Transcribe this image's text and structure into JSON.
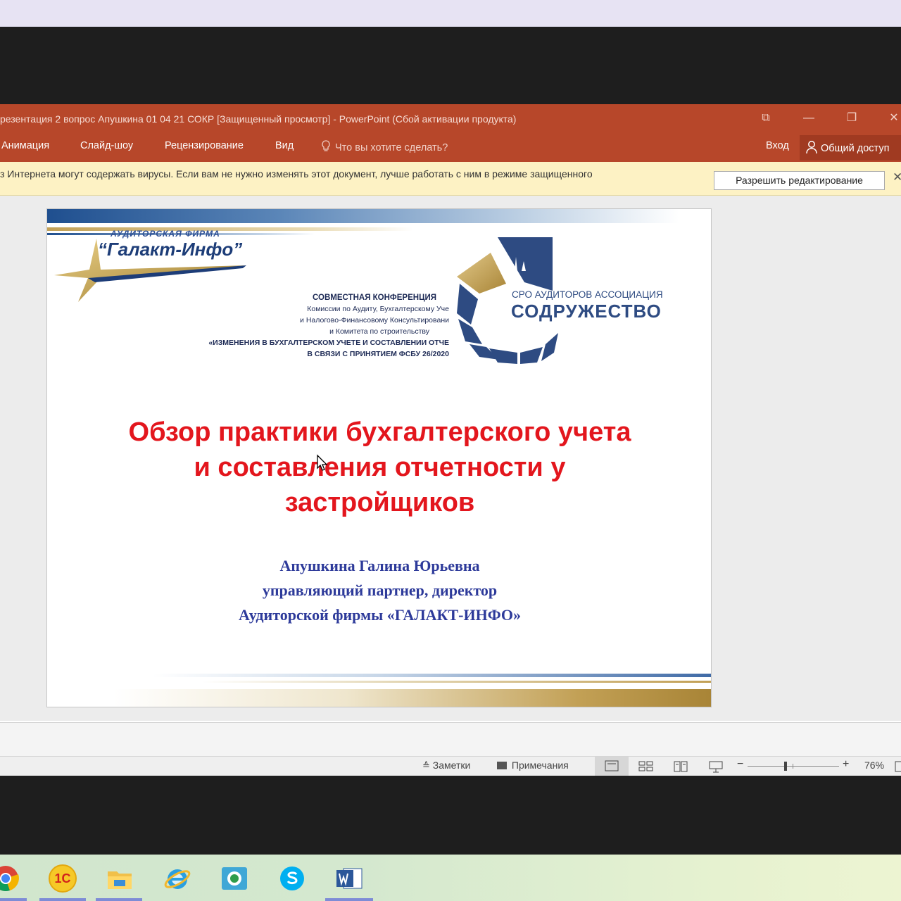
{
  "window": {
    "title": "резентация 2 вопрос Апушкина  01 04 21 СОКР [Защищенный просмотр] - PowerPoint (Сбой активации продукта)",
    "controls": {
      "ribbon_display": "⧉",
      "minimize": "—",
      "restore": "❐",
      "close": "✕"
    }
  },
  "ribbon": {
    "tabs": [
      "Анимация",
      "Слайд-шоу",
      "Рецензирование",
      "Вид"
    ],
    "tell_me": "Что вы хотите сделать?",
    "sign_in": "Вход",
    "share": "Общий доступ"
  },
  "message_bar": {
    "text": "з Интернета могут содержать вирусы. Если вам не нужно изменять этот документ, лучше работать с ним в режиме защищенного",
    "enable_button": "Разрешить редактирование",
    "close": "✕"
  },
  "slide": {
    "logo_left": {
      "caption": "АУДИТОРСКАЯ  ФИРМА",
      "name": "“Галакт-Инфо”"
    },
    "logo_right": {
      "line1": "СРО АУДИТОРОВ АССОЦИАЦИЯ",
      "line2": "СОДРУЖЕСТВО"
    },
    "conference": [
      "СОВМЕСТНАЯ КОНФЕРЕНЦИЯ",
      "Комиссии по Аудиту, Бухгалтерскому Уче",
      "и Налогово-Финансовому Консультировани",
      "и Комитета по строительству",
      "«ИЗМЕНЕНИЯ В БУХГАЛТЕРСКОМ УЧЕТЕ И СОСТАВЛЕНИИ ОТЧЕ",
      "В СВЯЗИ С ПРИНЯТИЕМ ФСБУ 26/2020"
    ],
    "title_lines": [
      "Обзор практики бухгалтерского учета",
      "и составления отчетности у",
      "застройщиков"
    ],
    "author_lines": [
      "Апушкина Галина Юрьевна",
      "управляющий партнер, директор",
      "Аудиторской фирмы «ГАЛАКТ-ИНФО»"
    ]
  },
  "statusbar": {
    "notes": "Заметки",
    "comments": "Примечания",
    "zoom_minus": "−",
    "zoom_plus": "+",
    "zoom": "76%",
    "zoom_level": 0.4
  },
  "taskbar": {
    "apps": [
      "chrome-icon",
      "1c-icon",
      "file-explorer-icon",
      "internet-explorer-icon",
      "remote-app-icon",
      "skype-icon",
      "word-icon"
    ],
    "onec_text": "1С"
  },
  "colors": {
    "ppt_accent": "#b7472a",
    "title_red": "#e3161d",
    "author_blue": "#2d3a9a",
    "sodruzhestvo_blue": "#2e4b82",
    "gold": "#c2a055"
  }
}
